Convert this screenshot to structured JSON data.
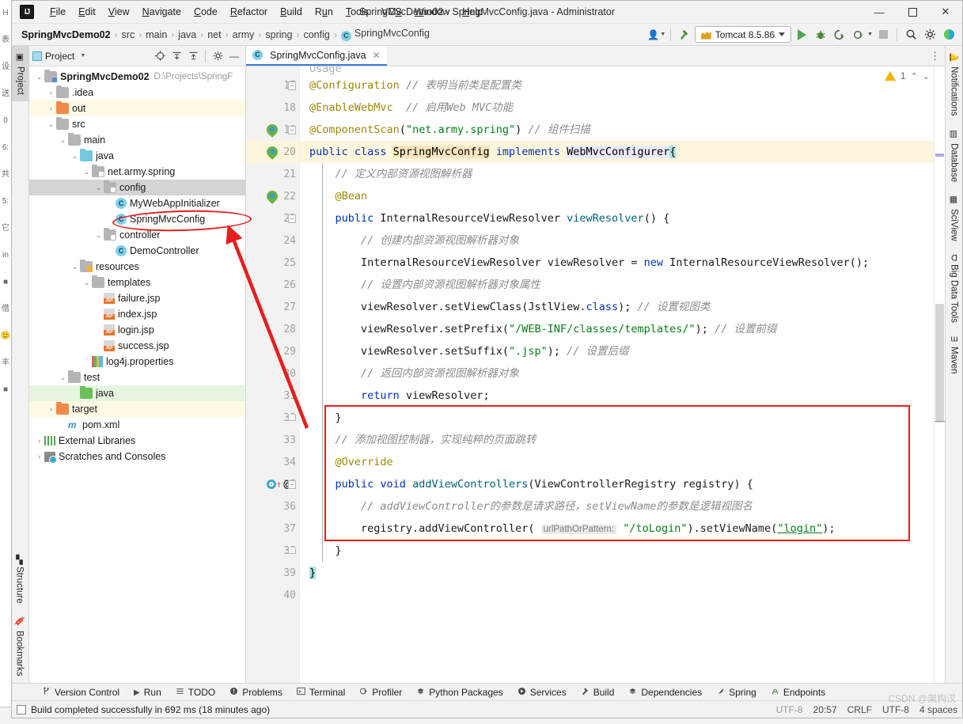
{
  "window": {
    "title": "SpringMvcDemo02 - SpringMvcConfig.java - Administrator",
    "logo": "IJ",
    "minimize": "—",
    "maximize": "▢",
    "close": "✕"
  },
  "menu": {
    "items": [
      {
        "label": "File"
      },
      {
        "label": "Edit"
      },
      {
        "label": "View"
      },
      {
        "label": "Navigate"
      },
      {
        "label": "Code"
      },
      {
        "label": "Refactor"
      },
      {
        "label": "Build"
      },
      {
        "label": "Run"
      },
      {
        "label": "Tools"
      },
      {
        "label": "VCS"
      },
      {
        "label": "Window"
      },
      {
        "label": "Help"
      }
    ]
  },
  "navbar": {
    "crumbs": [
      {
        "label": "SpringMvcDemo02",
        "type": "project"
      },
      {
        "label": "src",
        "type": "dir"
      },
      {
        "label": "main",
        "type": "dir"
      },
      {
        "label": "java",
        "type": "dir"
      },
      {
        "label": "net",
        "type": "dir"
      },
      {
        "label": "army",
        "type": "dir"
      },
      {
        "label": "spring",
        "type": "dir"
      },
      {
        "label": "config",
        "type": "dir"
      },
      {
        "label": "SpringMvcConfig",
        "type": "class",
        "badge": "C"
      }
    ],
    "separator": "›",
    "run_config": "Tomcat 8.5.86",
    "icons": [
      {
        "name": "user-settings-icon",
        "glyph": "⚙"
      },
      {
        "name": "build-hammer-icon",
        "glyph": "⚒"
      },
      {
        "name": "run-button",
        "glyph": "▶"
      },
      {
        "name": "debug-button",
        "glyph": "ὁE"
      },
      {
        "name": "run-with-coverage-icon",
        "glyph": "◔"
      },
      {
        "name": "profiler-icon",
        "glyph": "◎"
      },
      {
        "name": "stop-button",
        "glyph": "■"
      },
      {
        "name": "search-everywhere-icon",
        "glyph": "⚲"
      },
      {
        "name": "settings-gear-icon",
        "glyph": "⚙"
      },
      {
        "name": "ide-assistant-icon",
        "glyph": "◗"
      }
    ]
  },
  "left_strip": {
    "top_tab": "Project",
    "bottom_tabs": [
      "Structure",
      "Bookmarks"
    ]
  },
  "right_strip": {
    "tabs": [
      "Notifications",
      "Database",
      "SciView",
      "Big Data Tools",
      "Maven"
    ]
  },
  "project_window": {
    "title": "Project",
    "header_icons": [
      "target-icon",
      "expand-icon",
      "collapse-icon",
      "gear-icon",
      "hide-icon"
    ],
    "tree": [
      {
        "depth": 0,
        "twist": "v",
        "icon": "module",
        "label": "SpringMvcDemo02",
        "bold": true,
        "path": "D:\\Projects\\SpringF",
        "state": ""
      },
      {
        "depth": 1,
        "twist": ">",
        "icon": "folder",
        "label": ".idea",
        "state": ""
      },
      {
        "depth": 1,
        "twist": ">",
        "icon": "folder-orange",
        "label": "out",
        "state": "hl-yellow"
      },
      {
        "depth": 1,
        "twist": "v",
        "icon": "folder",
        "label": "src",
        "state": ""
      },
      {
        "depth": 2,
        "twist": "v",
        "icon": "folder",
        "label": "main",
        "state": ""
      },
      {
        "depth": 3,
        "twist": "v",
        "icon": "folder-blue",
        "label": "java",
        "state": ""
      },
      {
        "depth": 4,
        "twist": "v",
        "icon": "package",
        "label": "net.army.spring",
        "state": ""
      },
      {
        "depth": 5,
        "twist": "v",
        "icon": "package",
        "label": "config",
        "state": "sel"
      },
      {
        "depth": 6,
        "twist": "",
        "icon": "class",
        "label": "MyWebAppInitializer",
        "state": ""
      },
      {
        "depth": 6,
        "twist": "",
        "icon": "class",
        "label": "SpringMvcConfig",
        "state": ""
      },
      {
        "depth": 5,
        "twist": "v",
        "icon": "package",
        "label": "controller",
        "state": ""
      },
      {
        "depth": 6,
        "twist": "",
        "icon": "class",
        "label": "DemoController",
        "state": ""
      },
      {
        "depth": 3,
        "twist": "v",
        "icon": "folder-res",
        "label": "resources",
        "state": ""
      },
      {
        "depth": 4,
        "twist": "v",
        "icon": "folder",
        "label": "templates",
        "state": ""
      },
      {
        "depth": 5,
        "twist": "",
        "icon": "jsp",
        "label": "failure.jsp",
        "state": ""
      },
      {
        "depth": 5,
        "twist": "",
        "icon": "jsp",
        "label": "index.jsp",
        "state": ""
      },
      {
        "depth": 5,
        "twist": "",
        "icon": "jsp",
        "label": "login.jsp",
        "state": ""
      },
      {
        "depth": 5,
        "twist": "",
        "icon": "jsp",
        "label": "success.jsp",
        "state": ""
      },
      {
        "depth": 4,
        "twist": "",
        "icon": "properties",
        "label": "log4j.properties",
        "state": ""
      },
      {
        "depth": 2,
        "twist": "v",
        "icon": "folder",
        "label": "test",
        "state": ""
      },
      {
        "depth": 3,
        "twist": "",
        "icon": "folder-green",
        "label": "java",
        "state": "hl-green"
      },
      {
        "depth": 1,
        "twist": ">",
        "icon": "folder-orange",
        "label": "target",
        "state": "hl-yellow"
      },
      {
        "depth": 2,
        "twist": "",
        "icon": "maven",
        "label": "pom.xml",
        "state": ""
      },
      {
        "depth": 0,
        "twist": ">",
        "icon": "libraries",
        "label": "External Libraries",
        "state": ""
      },
      {
        "depth": 0,
        "twist": ">",
        "icon": "scratches",
        "label": "Scratches and Consoles",
        "state": ""
      }
    ]
  },
  "editor": {
    "tab": {
      "label": "SpringMvcConfig.java",
      "badge": "C",
      "close": "✕"
    },
    "inspection": {
      "warning_count": "1",
      "up": "⌃",
      "down": "⌄"
    },
    "tabs_menu_icon": "⋮",
    "first_partial_line": "Usage",
    "lines": [
      {
        "num": "17",
        "marks": [],
        "fold": "minus",
        "current": false,
        "indent": false,
        "tokens": [
          {
            "t": "@Configuration",
            "c": "ann"
          },
          {
            "t": " ",
            "c": ""
          },
          {
            "t": "// 表明当前类是配置类",
            "c": "cm"
          }
        ]
      },
      {
        "num": "18",
        "marks": [],
        "fold": "",
        "current": false,
        "indent": false,
        "tokens": [
          {
            "t": "@EnableWebMvc",
            "c": "ann"
          },
          {
            "t": "  ",
            "c": ""
          },
          {
            "t": "// 启用Web MVC功能",
            "c": "cm"
          }
        ]
      },
      {
        "num": "19",
        "marks": [
          "spring-bean"
        ],
        "fold": "minus",
        "current": false,
        "indent": false,
        "tokens": [
          {
            "t": "@ComponentScan",
            "c": "ann"
          },
          {
            "t": "(",
            "c": "ty"
          },
          {
            "t": "\"net.army.spring\"",
            "c": "st"
          },
          {
            "t": ") ",
            "c": "ty"
          },
          {
            "t": "// 组件扫描",
            "c": "cm"
          }
        ]
      },
      {
        "num": "20",
        "marks": [
          "spring-bean"
        ],
        "fold": "",
        "current": true,
        "indent": false,
        "tokens": [
          {
            "t": "public class ",
            "c": "k"
          },
          {
            "t": "SpringMvcConfig",
            "c": "hl-class"
          },
          {
            "t": " ",
            "c": ""
          },
          {
            "t": "implements",
            "c": "k"
          },
          {
            "t": " ",
            "c": ""
          },
          {
            "t": "WebMvcConfigurer",
            "c": "hl-iface"
          },
          {
            "t": "{",
            "c": "cursor-brace"
          }
        ]
      },
      {
        "num": "21",
        "marks": [],
        "fold": "",
        "current": false,
        "indent": true,
        "tokens": [
          {
            "t": "    ",
            "c": ""
          },
          {
            "t": "// 定义内部资源视图解析器",
            "c": "cm"
          }
        ]
      },
      {
        "num": "22",
        "marks": [
          "spring-bean"
        ],
        "fold": "",
        "current": false,
        "indent": true,
        "tokens": [
          {
            "t": "    ",
            "c": ""
          },
          {
            "t": "@Bean",
            "c": "ann"
          }
        ]
      },
      {
        "num": "23",
        "marks": [],
        "fold": "minus",
        "current": false,
        "indent": true,
        "tokens": [
          {
            "t": "    ",
            "c": ""
          },
          {
            "t": "public",
            "c": "k"
          },
          {
            "t": " InternalResourceViewResolver ",
            "c": "ty"
          },
          {
            "t": "viewResolver",
            "c": "mth"
          },
          {
            "t": "() {",
            "c": "ty"
          }
        ]
      },
      {
        "num": "24",
        "marks": [],
        "fold": "",
        "current": false,
        "indent": true,
        "tokens": [
          {
            "t": "        ",
            "c": ""
          },
          {
            "t": "// 创建内部资源视图解析器对象",
            "c": "cm"
          }
        ]
      },
      {
        "num": "25",
        "marks": [],
        "fold": "",
        "current": false,
        "indent": true,
        "tokens": [
          {
            "t": "        InternalResourceViewResolver viewResolver = ",
            "c": "ty"
          },
          {
            "t": "new",
            "c": "k"
          },
          {
            "t": " InternalResourceViewResolver();",
            "c": "ty"
          }
        ]
      },
      {
        "num": "26",
        "marks": [],
        "fold": "",
        "current": false,
        "indent": true,
        "tokens": [
          {
            "t": "        ",
            "c": ""
          },
          {
            "t": "// 设置内部资源视图解析器对象属性",
            "c": "cm"
          }
        ]
      },
      {
        "num": "27",
        "marks": [],
        "fold": "",
        "current": false,
        "indent": true,
        "tokens": [
          {
            "t": "        viewResolver.setViewClass(JstlView.",
            "c": "ty"
          },
          {
            "t": "class",
            "c": "k"
          },
          {
            "t": "); ",
            "c": "ty"
          },
          {
            "t": "// 设置视图类",
            "c": "cm"
          }
        ]
      },
      {
        "num": "28",
        "marks": [],
        "fold": "",
        "current": false,
        "indent": true,
        "tokens": [
          {
            "t": "        viewResolver.setPrefix(",
            "c": "ty"
          },
          {
            "t": "\"/WEB-INF/classes/templates/\"",
            "c": "st"
          },
          {
            "t": "); ",
            "c": "ty"
          },
          {
            "t": "// 设置前缀",
            "c": "cm"
          }
        ]
      },
      {
        "num": "29",
        "marks": [],
        "fold": "",
        "current": false,
        "indent": true,
        "tokens": [
          {
            "t": "        viewResolver.setSuffix(",
            "c": "ty"
          },
          {
            "t": "\".jsp\"",
            "c": "st"
          },
          {
            "t": "); ",
            "c": "ty"
          },
          {
            "t": "// 设置后缀",
            "c": "cm"
          }
        ]
      },
      {
        "num": "30",
        "marks": [],
        "fold": "",
        "current": false,
        "indent": true,
        "tokens": [
          {
            "t": "        ",
            "c": ""
          },
          {
            "t": "// 返回内部资源视图解析器对象",
            "c": "cm"
          }
        ]
      },
      {
        "num": "31",
        "marks": [],
        "fold": "",
        "current": false,
        "indent": true,
        "tokens": [
          {
            "t": "        ",
            "c": ""
          },
          {
            "t": "return",
            "c": "k"
          },
          {
            "t": " viewResolver;",
            "c": "ty"
          }
        ]
      },
      {
        "num": "32",
        "marks": [],
        "fold": "end",
        "current": false,
        "indent": true,
        "tokens": [
          {
            "t": "    }",
            "c": "ty"
          }
        ]
      },
      {
        "num": "33",
        "marks": [],
        "fold": "",
        "current": false,
        "indent": true,
        "tokens": [
          {
            "t": "    ",
            "c": ""
          },
          {
            "t": "// 添加视图控制器，实现纯粹的页面跳转",
            "c": "cm"
          }
        ]
      },
      {
        "num": "34",
        "marks": [],
        "fold": "",
        "current": false,
        "indent": true,
        "tokens": [
          {
            "t": "    ",
            "c": ""
          },
          {
            "t": "@Override",
            "c": "ann"
          }
        ]
      },
      {
        "num": "35",
        "marks": [
          "override",
          "at"
        ],
        "fold": "minus",
        "current": false,
        "indent": true,
        "tokens": [
          {
            "t": "    ",
            "c": ""
          },
          {
            "t": "public void ",
            "c": "k"
          },
          {
            "t": "addViewControllers",
            "c": "mth"
          },
          {
            "t": "(ViewControllerRegistry registry) {",
            "c": "ty"
          }
        ]
      },
      {
        "num": "36",
        "marks": [],
        "fold": "",
        "current": false,
        "indent": true,
        "tokens": [
          {
            "t": "        ",
            "c": ""
          },
          {
            "t": "// addViewController的参数是请求路径，setViewName的参数是逻辑视图名",
            "c": "cm"
          }
        ]
      },
      {
        "num": "37",
        "marks": [],
        "fold": "",
        "current": false,
        "indent": true,
        "tokens": [
          {
            "t": "        registry.addViewController( ",
            "c": "ty"
          },
          {
            "t": "urlPathOrPattern:",
            "c": "hint"
          },
          {
            "t": " ",
            "c": ""
          },
          {
            "t": "\"/toLogin\"",
            "c": "st"
          },
          {
            "t": ").setViewName(",
            "c": "ty"
          },
          {
            "t": "\"login\"",
            "c": "st-link"
          },
          {
            "t": ");",
            "c": "ty"
          }
        ]
      },
      {
        "num": "38",
        "marks": [],
        "fold": "end",
        "current": false,
        "indent": true,
        "tokens": [
          {
            "t": "    }",
            "c": "ty"
          }
        ]
      },
      {
        "num": "39",
        "marks": [],
        "fold": "",
        "current": false,
        "indent": false,
        "tokens": [
          {
            "t": "}",
            "c": "cursor-brace"
          }
        ]
      },
      {
        "num": "40",
        "marks": [],
        "fold": "",
        "current": false,
        "indent": false,
        "tokens": []
      }
    ]
  },
  "bottom_tabs": [
    {
      "label": "Version Control",
      "icon": "branch-icon"
    },
    {
      "label": "Run",
      "icon": "run-icon"
    },
    {
      "label": "TODO",
      "icon": "todo-icon"
    },
    {
      "label": "Problems",
      "icon": "problems-icon"
    },
    {
      "label": "Terminal",
      "icon": "terminal-icon"
    },
    {
      "label": "Profiler",
      "icon": "profiler-icon"
    },
    {
      "label": "Python Packages",
      "icon": "python-icon"
    },
    {
      "label": "Services",
      "icon": "services-icon"
    },
    {
      "label": "Build",
      "icon": "build-icon"
    },
    {
      "label": "Dependencies",
      "icon": "dependencies-icon"
    },
    {
      "label": "Spring",
      "icon": "spring-icon"
    },
    {
      "label": "Endpoints",
      "icon": "endpoints-icon"
    }
  ],
  "statusbar": {
    "message": "Build completed successfully in 692 ms (18 minutes ago)",
    "encoding_left": "UTF-8",
    "position": "20:57",
    "line_separator": "CRLF",
    "encoding": "UTF-8",
    "indent": "4 spaces",
    "watermark": "CSDN @架构汉"
  },
  "colors": {
    "accent_blue": "#3a7fd5",
    "annotation_red": "#e81e1e",
    "spring_green": "#6cb33f",
    "keyword_blue": "#0033b3",
    "string_green": "#067d17",
    "comment_gray": "#8c8c8c",
    "annotation_gold": "#9e880d"
  }
}
